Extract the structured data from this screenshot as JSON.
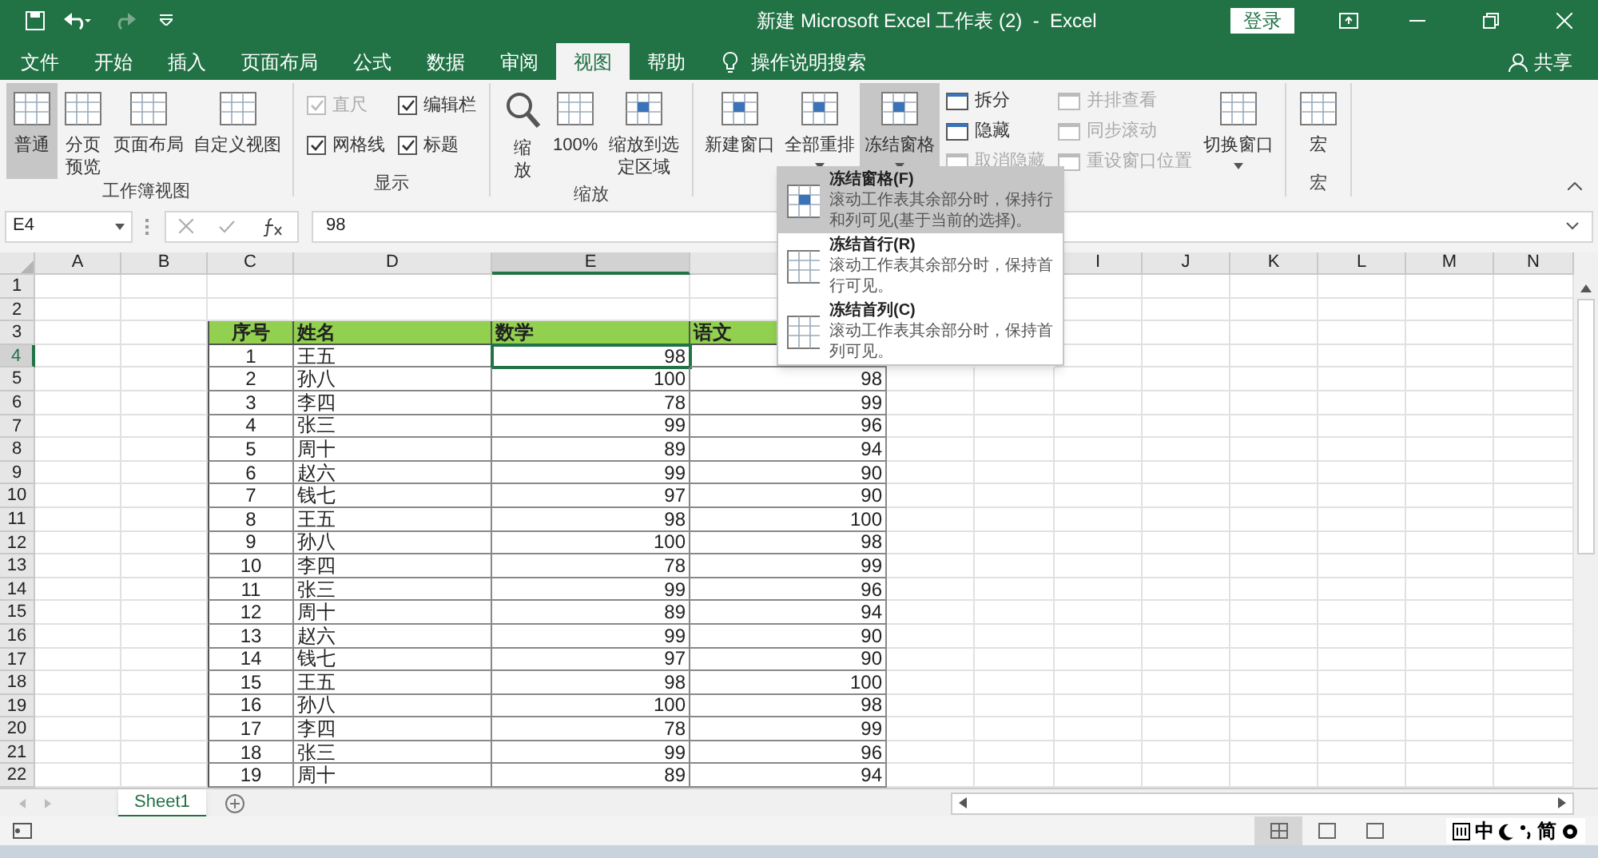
{
  "title_bar": {
    "title": "新建 Microsoft Excel 工作表 (2)  -  Excel",
    "sign_in": "登录"
  },
  "tabs": [
    {
      "label": "文件",
      "selected": false
    },
    {
      "label": "开始",
      "selected": false
    },
    {
      "label": "插入",
      "selected": false
    },
    {
      "label": "页面布局",
      "selected": false
    },
    {
      "label": "公式",
      "selected": false
    },
    {
      "label": "数据",
      "selected": false
    },
    {
      "label": "审阅",
      "selected": false
    },
    {
      "label": "视图",
      "selected": true
    },
    {
      "label": "帮助",
      "selected": false
    }
  ],
  "search": "操作说明搜索",
  "share": "共享",
  "ribbon": [
    {
      "label": "工作簿视图",
      "items": [
        {
          "kind": "large",
          "label": "普通",
          "selected": true
        },
        {
          "kind": "large",
          "label": "分页预览",
          "selected": false
        },
        {
          "kind": "large",
          "label": "页面布局",
          "selected": false
        },
        {
          "kind": "large",
          "label": "自定义视图",
          "selected": false
        }
      ]
    },
    {
      "label": "显示",
      "items": [
        {
          "kind": "stack",
          "children": [
            {
              "kind": "check",
              "label": "直尺",
              "checked": true,
              "disabled": true
            },
            {
              "kind": "check",
              "label": "网格线",
              "checked": true,
              "disabled": false
            }
          ]
        },
        {
          "kind": "stack",
          "children": [
            {
              "kind": "check",
              "label": "编辑栏",
              "checked": true,
              "disabled": false
            },
            {
              "kind": "check",
              "label": "标题",
              "checked": true,
              "disabled": false
            }
          ]
        }
      ]
    },
    {
      "label": "缩放",
      "items": [
        {
          "kind": "large",
          "label": "缩放",
          "selected": false
        },
        {
          "kind": "large",
          "label": "100%",
          "selected": false
        },
        {
          "kind": "large",
          "label": "缩放到选定区域",
          "selected": false
        }
      ]
    },
    {
      "items": [
        {
          "kind": "large",
          "label": "新建窗口",
          "selected": false
        },
        {
          "kind": "large",
          "label": "全部重排",
          "selected": false
        },
        {
          "kind": "large",
          "label": "冻结窗格",
          "selected": true
        },
        {
          "kind": "stack",
          "children": [
            {
              "kind": "small",
              "label": "拆分",
              "disabled": false
            },
            {
              "kind": "small",
              "label": "隐藏",
              "disabled": false
            },
            {
              "kind": "small",
              "label": "取消隐藏",
              "disabled": true
            }
          ]
        },
        {
          "kind": "stack",
          "children": [
            {
              "kind": "small",
              "label": "并排查看",
              "disabled": true
            },
            {
              "kind": "small",
              "label": "同步滚动",
              "disabled": true
            },
            {
              "kind": "small",
              "label": "重设窗口位置",
              "disabled": true
            }
          ]
        },
        {
          "kind": "large",
          "label": "切换窗口",
          "selected": false
        }
      ]
    },
    {
      "label": "宏",
      "items": [
        {
          "kind": "large",
          "label": "宏",
          "selected": false
        }
      ]
    }
  ],
  "formula_bar": {
    "name_box": "E4",
    "formula": "98"
  },
  "column_headers": [
    "A",
    "B",
    "C",
    "D",
    "E",
    "I",
    "J",
    "K",
    "L",
    "M",
    "N"
  ],
  "row_headers": [
    "1",
    "2",
    "3",
    "4",
    "5",
    "6",
    "7",
    "8",
    "9",
    "10",
    "11",
    "12",
    "13",
    "14",
    "15",
    "16",
    "17",
    "18",
    "19",
    "20",
    "21",
    "22"
  ],
  "table": {
    "header": [
      "序号",
      "姓名",
      "数学",
      "语文"
    ],
    "rows": [
      {
        "no": "1",
        "name": "王五",
        "math": "98",
        "selected": true
      },
      {
        "no": "2",
        "name": "孙八",
        "math": "100",
        "chinese": "98",
        "selected": false
      },
      {
        "no": "3",
        "name": "李四",
        "math": "78",
        "chinese": "99",
        "selected": false
      },
      {
        "no": "4",
        "name": "张三",
        "math": "99",
        "chinese": "96",
        "selected": false
      },
      {
        "no": "5",
        "name": "周十",
        "math": "89",
        "chinese": "94",
        "selected": false
      },
      {
        "no": "6",
        "name": "赵六",
        "math": "99",
        "chinese": "90",
        "selected": false
      },
      {
        "no": "7",
        "name": "钱七",
        "math": "97",
        "chinese": "90",
        "selected": false
      },
      {
        "no": "8",
        "name": "王五",
        "math": "98",
        "chinese": "100",
        "selected": false
      },
      {
        "no": "9",
        "name": "孙八",
        "math": "100",
        "chinese": "98",
        "selected": false
      },
      {
        "no": "10",
        "name": "李四",
        "math": "78",
        "chinese": "99",
        "selected": false
      },
      {
        "no": "11",
        "name": "张三",
        "math": "99",
        "chinese": "96",
        "selected": false
      },
      {
        "no": "12",
        "name": "周十",
        "math": "89",
        "chinese": "94",
        "selected": false
      },
      {
        "no": "13",
        "name": "赵六",
        "math": "99",
        "chinese": "90",
        "selected": false
      },
      {
        "no": "14",
        "name": "钱七",
        "math": "97",
        "chinese": "90",
        "selected": false
      },
      {
        "no": "15",
        "name": "王五",
        "math": "98",
        "chinese": "100",
        "selected": false
      },
      {
        "no": "16",
        "name": "孙八",
        "math": "100",
        "chinese": "98",
        "selected": false
      },
      {
        "no": "17",
        "name": "李四",
        "math": "78",
        "chinese": "99",
        "selected": false
      },
      {
        "no": "18",
        "name": "张三",
        "math": "99",
        "chinese": "96",
        "selected": false
      },
      {
        "no": "19",
        "name": "周十",
        "math": "89",
        "chinese": "94",
        "selected": false
      }
    ]
  },
  "freeze_menu": [
    {
      "title": "冻结窗格(F)",
      "description": "滚动工作表其余部分时，保持行和列可见(基于当前的选择)。",
      "selected": true
    },
    {
      "title": "冻结首行(R)",
      "description": "滚动工作表其余部分时，保持首行可见。",
      "selected": false
    },
    {
      "title": "冻结首列(C)",
      "description": "滚动工作表其余部分时，保持首列可见。",
      "selected": false
    }
  ],
  "sheets": [
    {
      "label": "Sheet1",
      "selected": true
    }
  ],
  "status_views": [
    {
      "selected": true
    },
    {
      "selected": false
    },
    {
      "selected": false
    }
  ],
  "ime": [
    "中",
    "简"
  ]
}
